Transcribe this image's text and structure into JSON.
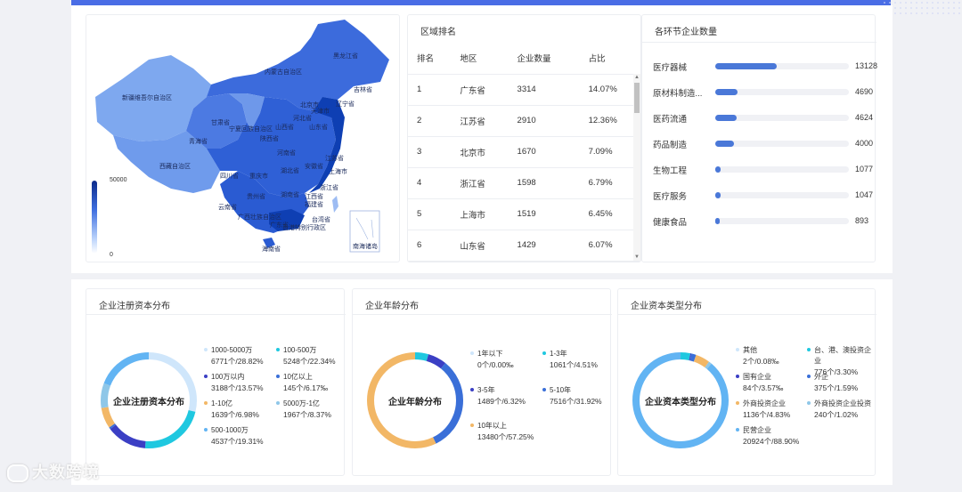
{
  "map": {
    "legend_max": "50000",
    "legend_min": "0",
    "inset_label": "南海诸岛",
    "province_labels": [
      {
        "name": "黑龙江省"
      },
      {
        "name": "内蒙古自治区"
      },
      {
        "name": "吉林省"
      },
      {
        "name": "辽宁省"
      },
      {
        "name": "新疆维吾尔自治区"
      },
      {
        "name": "北京市"
      },
      {
        "name": "天津市"
      },
      {
        "name": "河北省"
      },
      {
        "name": "山西省"
      },
      {
        "name": "宁夏回族自治区"
      },
      {
        "name": "甘肃省"
      },
      {
        "name": "青海省"
      },
      {
        "name": "山东省"
      },
      {
        "name": "陕西省"
      },
      {
        "name": "河南省"
      },
      {
        "name": "江苏省"
      },
      {
        "name": "西藏自治区"
      },
      {
        "name": "四川省"
      },
      {
        "name": "重庆市"
      },
      {
        "name": "湖北省"
      },
      {
        "name": "安徽省"
      },
      {
        "name": "上海市"
      },
      {
        "name": "浙江省"
      },
      {
        "name": "贵州省"
      },
      {
        "name": "湖南省"
      },
      {
        "name": "江西省"
      },
      {
        "name": "云南省"
      },
      {
        "name": "福建省"
      },
      {
        "name": "广西壮族自治区"
      },
      {
        "name": "广东省"
      },
      {
        "name": "台湾省"
      },
      {
        "name": "香港特别行政区"
      },
      {
        "name": "海南省"
      }
    ]
  },
  "ranking": {
    "title": "区域排名",
    "headers": [
      "排名",
      "地区",
      "企业数量",
      "占比"
    ],
    "rows": [
      {
        "rank": "1",
        "region": "广东省",
        "count": "3314",
        "ratio": "14.07%"
      },
      {
        "rank": "2",
        "region": "江苏省",
        "count": "2910",
        "ratio": "12.36%"
      },
      {
        "rank": "3",
        "region": "北京市",
        "count": "1670",
        "ratio": "7.09%"
      },
      {
        "rank": "4",
        "region": "浙江省",
        "count": "1598",
        "ratio": "6.79%"
      },
      {
        "rank": "5",
        "region": "上海市",
        "count": "1519",
        "ratio": "6.45%"
      },
      {
        "rank": "6",
        "region": "山东省",
        "count": "1429",
        "ratio": "6.07%"
      }
    ]
  },
  "chain": {
    "title": "各环节企业数量",
    "max": 13128,
    "items": [
      {
        "label": "医疗器械",
        "value": "13128",
        "num": 13128
      },
      {
        "label": "原材料制造...",
        "value": "4690",
        "num": 4690
      },
      {
        "label": "医药流通",
        "value": "4624",
        "num": 4624
      },
      {
        "label": "药品制造",
        "value": "4000",
        "num": 4000
      },
      {
        "label": "生物工程",
        "value": "1077",
        "num": 1077
      },
      {
        "label": "医疗服务",
        "value": "1047",
        "num": 1047
      },
      {
        "label": "健康食品",
        "value": "893",
        "num": 893
      }
    ]
  },
  "capital": {
    "title": "企业注册资本分布",
    "center": "企业注册资本分布",
    "segments": [
      {
        "label": "1000-5000万",
        "value": "6771个/28.82%",
        "pct": 28.82,
        "color": "#cfe6fb"
      },
      {
        "label": "100-500万",
        "value": "5248个/22.34%",
        "pct": 22.34,
        "color": "#1fc8e0"
      },
      {
        "label": "100万以内",
        "value": "3188个/13.57%",
        "pct": 13.57,
        "color": "#3b3fc4"
      },
      {
        "label": "10亿以上",
        "value": "145个/6.17‰",
        "pct": 0.62,
        "color": "#3a6fd8"
      },
      {
        "label": "1-10亿",
        "value": "1639个/6.98%",
        "pct": 6.98,
        "color": "#f2b766"
      },
      {
        "label": "5000万-1亿",
        "value": "1967个/8.37%",
        "pct": 8.37,
        "color": "#8fc7e8"
      },
      {
        "label": "500-1000万",
        "value": "4537个/19.31%",
        "pct": 19.31,
        "color": "#62b4f3"
      }
    ]
  },
  "age": {
    "title": "企业年龄分布",
    "center": "企业年龄分布",
    "segments": [
      {
        "label": "1年以下",
        "value": "0个/0.00‰",
        "pct": 0.0,
        "color": "#cfe6fb"
      },
      {
        "label": "1-3年",
        "value": "1061个/4.51%",
        "pct": 4.51,
        "color": "#1fc8e0"
      },
      {
        "label": "3-5年",
        "value": "1489个/6.32%",
        "pct": 6.32,
        "color": "#3b3fc4"
      },
      {
        "label": "5-10年",
        "value": "7516个/31.92%",
        "pct": 31.92,
        "color": "#3a6fd8"
      },
      {
        "label": "10年以上",
        "value": "13480个/57.25%",
        "pct": 57.25,
        "color": "#f2b766"
      }
    ]
  },
  "captype": {
    "title": "企业资本类型分布",
    "center": "企业资本类型分布",
    "segments": [
      {
        "label": "其他",
        "value": "2个/0.08‰",
        "pct": 0.01,
        "color": "#cfe6fb"
      },
      {
        "label": "台、港、澳投资企业",
        "value": "776个/3.30%",
        "pct": 3.3,
        "color": "#1fc8e0"
      },
      {
        "label": "国有企业",
        "value": "84个/3.57‰",
        "pct": 0.36,
        "color": "#3b3fc4"
      },
      {
        "label": "外企",
        "value": "375个/1.59%",
        "pct": 1.59,
        "color": "#3a6fd8"
      },
      {
        "label": "外商投资企业",
        "value": "1136个/4.83%",
        "pct": 4.83,
        "color": "#f2b766"
      },
      {
        "label": "外商投资企业投资",
        "value": "240个/1.02%",
        "pct": 1.02,
        "color": "#8fc7e8"
      },
      {
        "label": "民营企业",
        "value": "20924个/88.90%",
        "pct": 88.9,
        "color": "#62b4f3"
      }
    ]
  },
  "watermark": "大数跨境"
}
